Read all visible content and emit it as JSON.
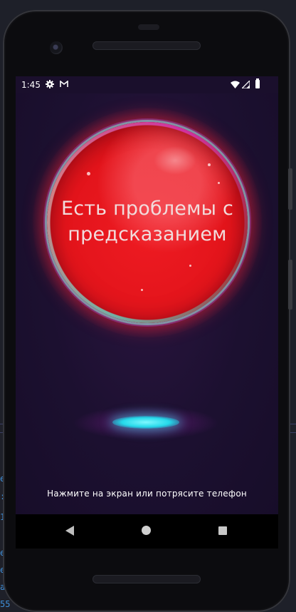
{
  "status_bar": {
    "time": "1:45",
    "icons": [
      "gear-icon",
      "gmail-icon",
      "wifi-icon",
      "signal-icon",
      "battery-icon"
    ]
  },
  "orb": {
    "message_line1": "Есть проблемы с",
    "message_line2": "предсказанием",
    "color": "#e3141b"
  },
  "pedestal": {
    "color": "#25d9ea"
  },
  "hint": "Нажмите на экран или потрясите телефон",
  "navigation": {
    "icons": [
      "back-icon",
      "home-icon",
      "recents-icon"
    ]
  },
  "colors": {
    "screen_bg": "#1c1030",
    "phone_body": "#0c0c0f"
  }
}
